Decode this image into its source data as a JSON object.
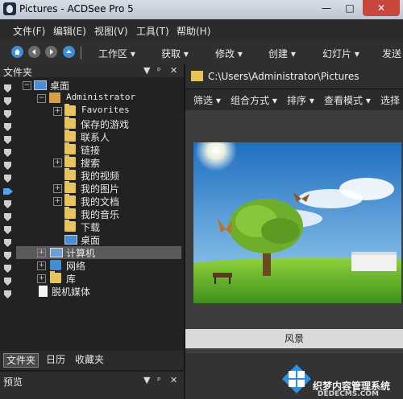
{
  "window": {
    "title": "Pictures - ACDSee Pro 5"
  },
  "menu": [
    "文件(F)",
    "编辑(E)",
    "视图(V)",
    "工具(T)",
    "帮助(H)"
  ],
  "toolbar": {
    "items": [
      "工作区 ▾",
      "获取 ▾",
      "修改 ▾",
      "创建 ▾",
      "幻灯片 ▾",
      "发送"
    ]
  },
  "folders_panel": {
    "title": "文件夹",
    "tree": [
      {
        "label": "桌面",
        "icon": "desktop-icon"
      },
      {
        "label": "Administrator",
        "icon": "user-folder-icon"
      },
      {
        "label": "Favorites",
        "icon": "folder-icon"
      },
      {
        "label": "保存的游戏",
        "icon": "folder-icon"
      },
      {
        "label": "联系人",
        "icon": "folder-icon"
      },
      {
        "label": "链接",
        "icon": "folder-icon"
      },
      {
        "label": "搜索",
        "icon": "folder-icon"
      },
      {
        "label": "我的视频",
        "icon": "folder-icon"
      },
      {
        "label": "我的图片",
        "icon": "folder-icon",
        "selected": true
      },
      {
        "label": "我的文档",
        "icon": "folder-icon"
      },
      {
        "label": "我的音乐",
        "icon": "folder-icon"
      },
      {
        "label": "下载",
        "icon": "folder-icon"
      },
      {
        "label": "桌面",
        "icon": "desktop-icon"
      },
      {
        "label": "计算机",
        "icon": "computer-icon"
      },
      {
        "label": "网络",
        "icon": "network-icon"
      },
      {
        "label": "库",
        "icon": "library-icon"
      },
      {
        "label": "脱机媒体",
        "icon": "page-icon"
      }
    ],
    "tabs": [
      "文件夹",
      "日历",
      "收藏夹"
    ]
  },
  "preview_panel": {
    "title": "预览"
  },
  "browser": {
    "path": "C:\\Users\\Administrator\\Pictures",
    "filter_items": [
      "筛选 ▾",
      "组合方式 ▾",
      "排序 ▾",
      "查看模式 ▾",
      "选择 ▾"
    ],
    "thumbnail_caption": "风景"
  },
  "watermark": {
    "text": "织梦内容管理系统",
    "url": "DEDECMS.COM"
  }
}
